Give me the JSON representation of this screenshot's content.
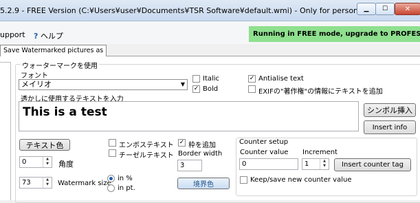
{
  "window": {
    "title": "5.2.9 - FREE Version (C:¥Users¥user¥Documents¥TSR Software¥default.wmi) - Only for personal use!",
    "controls": [
      "minimize",
      "maximize",
      "close"
    ]
  },
  "menu": {
    "support_label": "upport",
    "help_label": "ヘルプ"
  },
  "free_banner": "Running in FREE mode, upgrade to PROFESSIONAL",
  "tab_label": "Save Watermarked pictures as",
  "watermark": {
    "group_label": "ウォーターマークを使用",
    "font_label": "フォント",
    "font_value": "メイリオ",
    "italic": {
      "label": "Italic",
      "checked": false
    },
    "bold": {
      "label": "Bold",
      "checked": true
    },
    "antialias": {
      "label": "Antialise text",
      "checked": true
    },
    "exif": {
      "label": "EXIFの\"著作権\"の情報にテキストを追加",
      "checked": false
    },
    "text_label": "透かしに使用するテキストを入力",
    "text_value": "This is a test",
    "symbol_button": "シンボル挿入",
    "insert_info_button": "Insert info",
    "text_color_button": "テキスト色",
    "angle_value": "0",
    "angle_label": "角度",
    "size_value": "73",
    "size_label": "Watermark size",
    "emboss": {
      "label": "エンボステキスト",
      "checked": false
    },
    "chisel": {
      "label": "チーゼルテキスト",
      "checked": false
    },
    "border": {
      "label": "枠を追加",
      "checked": true
    },
    "border_width_label": "Border width",
    "border_width_value": "3",
    "border_color_button": "境界色",
    "size_units": [
      {
        "label": "in %",
        "selected": true
      },
      {
        "label": "in pt.",
        "selected": false
      }
    ]
  },
  "counter": {
    "group_label": "Counter setup",
    "value_label": "Counter value",
    "value": "0",
    "increment_label": "Increment",
    "increment": "1",
    "insert_button": "Insert counter tag",
    "keep_save": {
      "label": "Keep/save new counter value",
      "checked": false
    }
  }
}
